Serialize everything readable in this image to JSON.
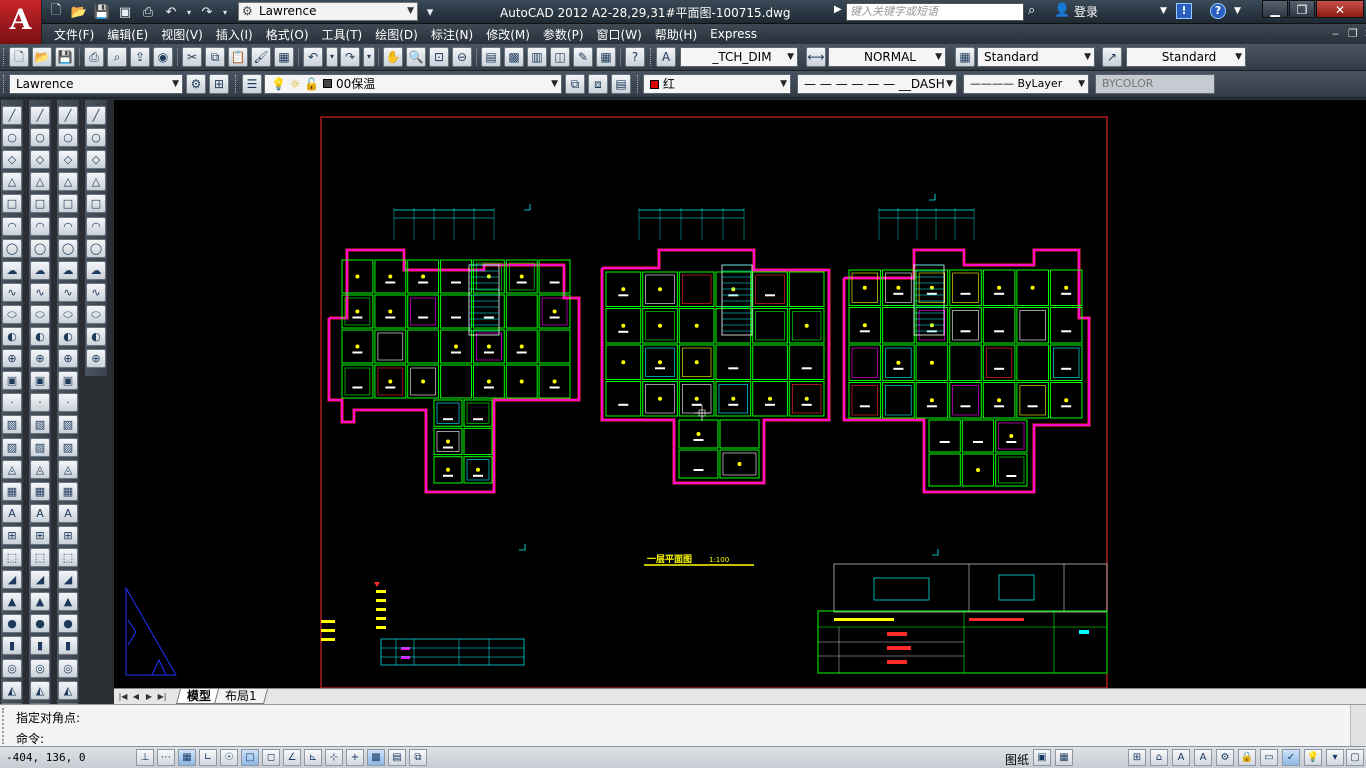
{
  "app": {
    "logo_letter": "A",
    "title": "AutoCAD 2012    A2-28,29,31#平面图-100715.dwg",
    "workspace": "Lawrence",
    "search_placeholder": "键入关键字或短语",
    "login_label": "登录",
    "help_icon": "?"
  },
  "menu": {
    "items": [
      "文件(F)",
      "编辑(E)",
      "视图(V)",
      "插入(I)",
      "格式(O)",
      "工具(T)",
      "绘图(D)",
      "标注(N)",
      "修改(M)",
      "参数(P)",
      "窗口(W)",
      "帮助(H)",
      "Express"
    ]
  },
  "toolbar1": {
    "dimstyle": "_TCH_DIM",
    "plotstyle": "NORMAL",
    "textstyle": "Standard",
    "tablestyle": "Standard"
  },
  "toolbar2": {
    "workspace": "Lawrence",
    "layer": "00保温",
    "color": "红",
    "color_hex": "#e00000",
    "linetype": "— — — — — —  __DASH",
    "lineweight": "———— ByLayer",
    "plotstyle": "BYCOLOR"
  },
  "drawing": {
    "background": "#000000",
    "sheet_title": "一层平面图",
    "sheet_scale": "1:100"
  },
  "tabs": {
    "model": "模型",
    "layout1": "布局1"
  },
  "command": {
    "history": "指定对角点:",
    "prompt": "命令:"
  },
  "status": {
    "coords": "-404, 136, 0",
    "paper_label": "图纸"
  }
}
